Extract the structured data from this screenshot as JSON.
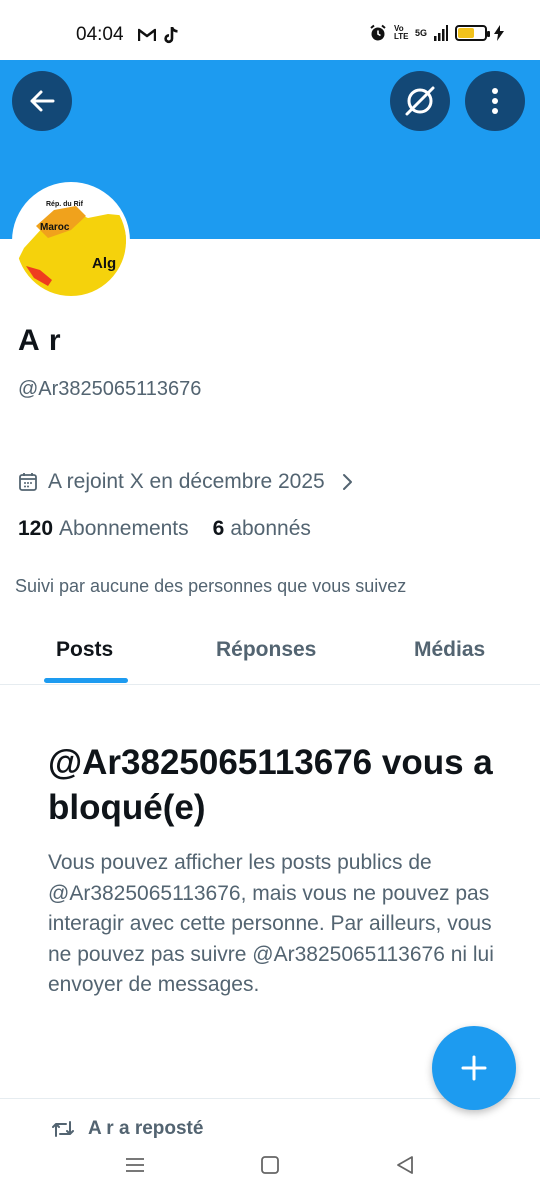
{
  "status_bar": {
    "time": "04:04",
    "network_volte": "Vo LTE",
    "network_5g": "5G",
    "battery_level": 0.6
  },
  "profile": {
    "name": "A r",
    "handle": "@Ar3825065113676",
    "avatar_map_labels": [
      "Rép. du Rif",
      "Maroc",
      "Alg"
    ],
    "joined": "A rejoint X en décembre 2025",
    "following_count": "120",
    "following_label": "Abonnements",
    "followers_count": "6",
    "followers_label": "abonnés",
    "followed_by": "Suivi par aucune des personnes que vous suivez"
  },
  "tabs": [
    {
      "label": "Posts",
      "active": true
    },
    {
      "label": "Réponses",
      "active": false
    },
    {
      "label": "Médias",
      "active": false
    }
  ],
  "blocked": {
    "title": "@Ar3825065113676 vous a bloqué(e)",
    "body": "Vous pouvez afficher les posts publics de @Ar3825065113676, mais vous ne pouvez pas interagir avec cette personne. Par ailleurs, vous ne pouvez pas suivre @Ar3825065113676 ni lui envoyer de messages."
  },
  "repost_line": "A r a reposté",
  "colors": {
    "accent": "#1d9bf0",
    "text_primary": "#0f1419",
    "text_secondary": "#536471"
  },
  "icons": {
    "back": "arrow-left-icon",
    "grok": "grok-icon",
    "more": "more-vertical-icon",
    "calendar": "calendar-icon",
    "chevron": "chevron-right-icon",
    "compose": "plus-icon",
    "repost": "repost-icon"
  }
}
